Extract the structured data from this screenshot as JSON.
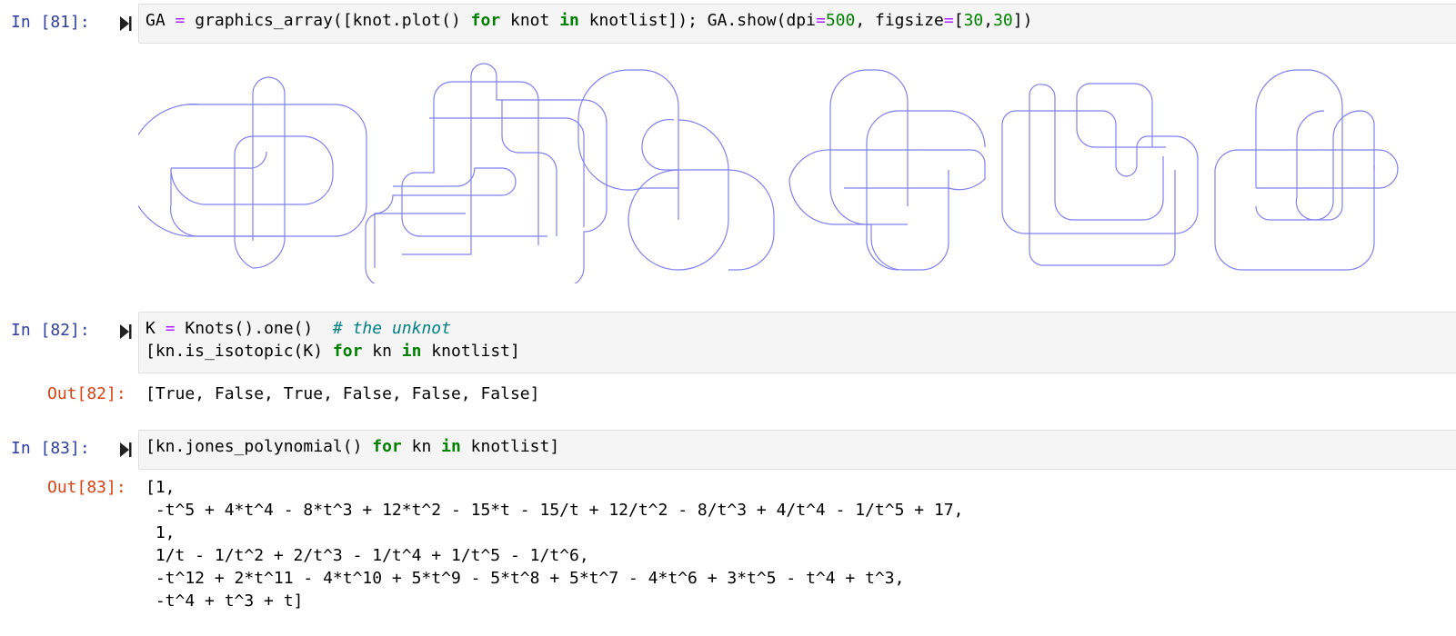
{
  "cells": [
    {
      "in_prompt": "In [81]:",
      "code": [
        [
          [
            "t",
            "GA "
          ],
          [
            "op",
            "="
          ],
          [
            "t",
            " graphics_array([knot.plot() "
          ],
          [
            "kw",
            "for"
          ],
          [
            "t",
            " knot "
          ],
          [
            "kw",
            "in"
          ],
          [
            "t",
            " knotlist]); GA.show(dpi"
          ],
          [
            "op",
            "="
          ],
          [
            "num",
            "500"
          ],
          [
            "t",
            ", figsize"
          ],
          [
            "op",
            "="
          ],
          [
            "t",
            "["
          ],
          [
            "num",
            "30"
          ],
          [
            "t",
            ","
          ],
          [
            "num",
            "30"
          ],
          [
            "t",
            "])"
          ]
        ]
      ]
    },
    {
      "in_prompt": "In [82]:",
      "code": [
        [
          [
            "t",
            "K "
          ],
          [
            "op",
            "="
          ],
          [
            "t",
            " Knots().one()  "
          ],
          [
            "cm",
            "# the unknot"
          ]
        ],
        [
          [
            "t",
            "[kn.is_isotopic(K) "
          ],
          [
            "kw",
            "for"
          ],
          [
            "t",
            " kn "
          ],
          [
            "kw",
            "in"
          ],
          [
            "t",
            " knotlist]"
          ]
        ]
      ],
      "out_prompt": "Out[82]:",
      "output": "[True, False, True, False, False, False]"
    },
    {
      "in_prompt": "In [83]:",
      "code": [
        [
          [
            "t",
            "[kn.jones_polynomial() "
          ],
          [
            "kw",
            "for"
          ],
          [
            "t",
            " kn "
          ],
          [
            "kw",
            "in"
          ],
          [
            "t",
            " knotlist]"
          ]
        ]
      ],
      "out_prompt": "Out[83]:",
      "output": "[1,\n -t^5 + 4*t^4 - 8*t^3 + 12*t^2 - 15*t - 15/t + 12/t^2 - 8/t^3 + 4/t^4 - 1/t^5 + 17,\n 1,\n 1/t - 1/t^2 + 2/t^3 - 1/t^4 + 1/t^5 - 1/t^6,\n -t^12 + 2*t^11 - 4*t^10 + 5*t^9 - 5*t^8 + 5*t^7 - 4*t^6 + 3*t^5 - t^4 + t^3,\n -t^4 + t^3 + t]"
    }
  ],
  "colors": {
    "in_prompt": "#303f9f",
    "out_prompt": "#d84315",
    "knot_stroke": "#8080f0",
    "keyword": "#008000",
    "operator": "#aa22ff",
    "comment": "#008080"
  },
  "icons": {
    "run": "run-cell-icon"
  }
}
